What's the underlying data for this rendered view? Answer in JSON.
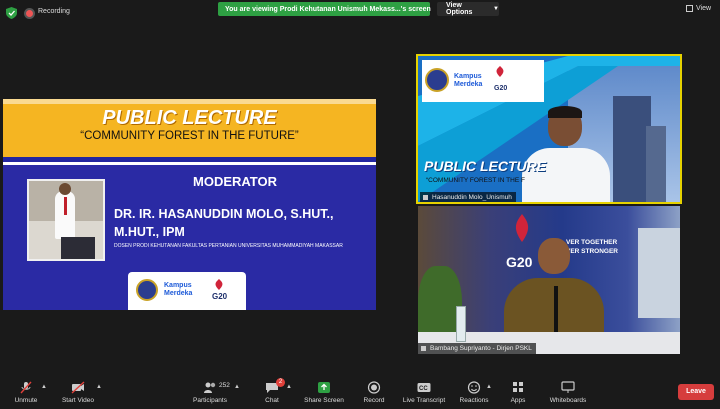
{
  "topbar": {
    "recording_label": "Recording",
    "share_banner": "You are viewing Prodi Kehutanan Unismuh Mekass...'s screen",
    "view_options": "View Options",
    "view_label": "View"
  },
  "slide": {
    "title": "PUBLIC LECTURE",
    "subtitle": "“COMMUNITY FOREST IN THE FUTURE”",
    "role": "MODERATOR",
    "name_line1": "DR. IR. HASANUDDIN MOLO, S.HUT.,",
    "name_line2": "M.HUT., IPM",
    "affiliation": "DOSEN PRODI KEHUTANAN FAKULTAS PERTANIAN UNIVERSITAS MUHAMMADIYAH MAKASSAR",
    "logo_text_1": "Kampus",
    "logo_text_2": "Merdeka",
    "logo_g20": "G20"
  },
  "tiles": [
    {
      "name": "Hasanuddin Molo_Unismuh",
      "title": "PUBLIC LECTURE",
      "subtitle": "“COMMUNITY FOREST IN THE F",
      "logo_text_1": "Kampus",
      "logo_text_2": "Merdeka",
      "logo_g20": "G20"
    },
    {
      "name": "Bambang Supriyanto - Dirjen PSKL",
      "backdrop_logo": "G20",
      "slogan_line1": "VER TOGETHER",
      "slogan_line2": "VER STRONGER"
    }
  ],
  "toolbar": {
    "unmute": "Unmute",
    "start_video": "Start Video",
    "participants": "Participants",
    "participants_count": "252",
    "chat": "Chat",
    "chat_badge": "2",
    "share_screen": "Share Screen",
    "record": "Record",
    "live_transcript": "Live Transcript",
    "cc": "CC",
    "reactions": "Reactions",
    "apps": "Apps",
    "whiteboards": "Whiteboards",
    "leave": "Leave"
  },
  "colors": {
    "share_green": "#2ea043",
    "leave_red": "#d63d3d",
    "slide_gold": "#f5b522",
    "slide_blue": "#2a2aa4",
    "active_speaker": "#e6d200"
  }
}
